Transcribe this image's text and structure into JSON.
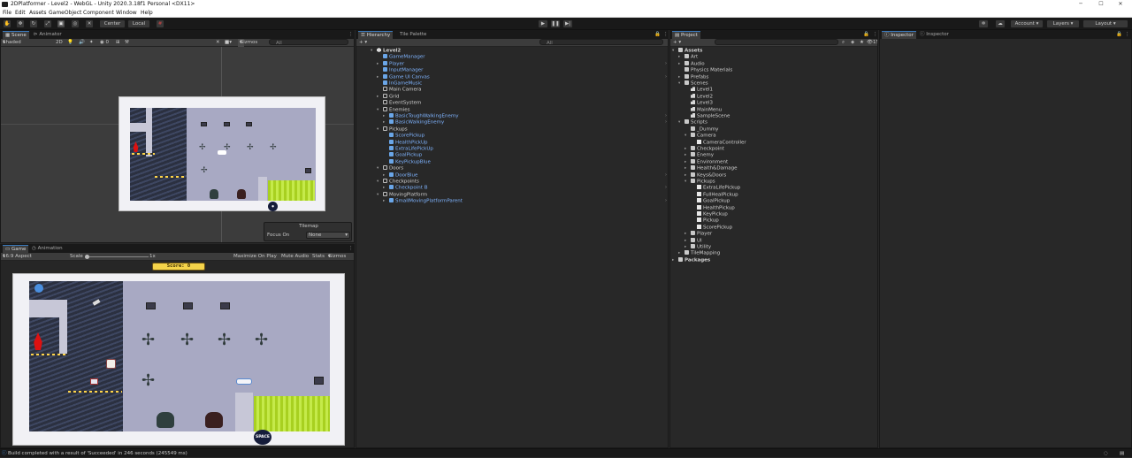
{
  "window": {
    "title": "2DPlatformer - Level2 - WebGL - Unity 2020.3.18f1 Personal <DX11>"
  },
  "menu": [
    "File",
    "Edit",
    "Assets",
    "GameObject",
    "Component",
    "Window",
    "Help"
  ],
  "toolbar": {
    "center": "Center",
    "local": "Local",
    "account": "Account",
    "layers": "Layers",
    "layout": "Layout"
  },
  "scene": {
    "tabs": [
      "Scene",
      "Animator"
    ],
    "shading": "Shaded",
    "mode2d": "2D",
    "gizmos": "Gizmos",
    "search_placeholder": "All",
    "tilemap": {
      "title": "Tilemap",
      "focus_label": "Focus On",
      "focus_value": "None"
    }
  },
  "game": {
    "tabs": [
      "Game",
      "Animation"
    ],
    "aspect": "16:9 Aspect",
    "scale_label": "Scale",
    "scale_value": "1x",
    "maximize": "Maximize On Play",
    "mute": "Mute Audio",
    "stats": "Stats",
    "gizmos": "Gizmos",
    "score": "Score: 0",
    "start_badge": "SPACE"
  },
  "hierarchy": {
    "tabs": [
      "Hierarchy",
      "Tile Palette"
    ],
    "search_placeholder": "All",
    "items": [
      {
        "label": "Level2",
        "depth": 0,
        "icon": "unity",
        "prefab": false,
        "arrow": "▾",
        "bold": true
      },
      {
        "label": "GameManager",
        "depth": 1,
        "icon": "cube",
        "prefab": true,
        "arrow": ""
      },
      {
        "label": "Player",
        "depth": 1,
        "icon": "cube",
        "prefab": true,
        "arrow": "▸"
      },
      {
        "label": "InputManager",
        "depth": 1,
        "icon": "cube",
        "prefab": true,
        "arrow": ""
      },
      {
        "label": "Game UI Canvas",
        "depth": 1,
        "icon": "cube",
        "prefab": true,
        "arrow": "▸"
      },
      {
        "label": "InGameMusic",
        "depth": 1,
        "icon": "cube",
        "prefab": true,
        "arrow": ""
      },
      {
        "label": "Main Camera",
        "depth": 1,
        "icon": "go",
        "prefab": false,
        "arrow": ""
      },
      {
        "label": "Grid",
        "depth": 1,
        "icon": "go",
        "prefab": false,
        "arrow": "▸"
      },
      {
        "label": "EventSystem",
        "depth": 1,
        "icon": "go",
        "prefab": false,
        "arrow": ""
      },
      {
        "label": "Enemies",
        "depth": 1,
        "icon": "go",
        "prefab": false,
        "arrow": "▾"
      },
      {
        "label": "BasicToughWalkingEnemy",
        "depth": 2,
        "icon": "cube",
        "prefab": true,
        "arrow": "▸"
      },
      {
        "label": "BasicWalkingEnemy",
        "depth": 2,
        "icon": "cube",
        "prefab": true,
        "arrow": "▸"
      },
      {
        "label": "Pickups",
        "depth": 1,
        "icon": "go",
        "prefab": false,
        "arrow": "▾"
      },
      {
        "label": "ScorePickup",
        "depth": 2,
        "icon": "cube",
        "prefab": true,
        "arrow": ""
      },
      {
        "label": "HealthPickUp",
        "depth": 2,
        "icon": "cube",
        "prefab": true,
        "arrow": ""
      },
      {
        "label": "ExtraLifePickUp",
        "depth": 2,
        "icon": "cube",
        "prefab": true,
        "arrow": ""
      },
      {
        "label": "GoalPickup",
        "depth": 2,
        "icon": "cube",
        "prefab": true,
        "arrow": ""
      },
      {
        "label": "KeyPickupBlue",
        "depth": 2,
        "icon": "cube",
        "prefab": true,
        "arrow": ""
      },
      {
        "label": "Doors",
        "depth": 1,
        "icon": "go",
        "prefab": false,
        "arrow": "▾"
      },
      {
        "label": "DoorBlue",
        "depth": 2,
        "icon": "cube",
        "prefab": true,
        "arrow": "▸"
      },
      {
        "label": "Checkpoints",
        "depth": 1,
        "icon": "go",
        "prefab": false,
        "arrow": "▾"
      },
      {
        "label": "Checkpoint B",
        "depth": 2,
        "icon": "cube",
        "prefab": true,
        "arrow": "▸"
      },
      {
        "label": "MovingPlatform",
        "depth": 1,
        "icon": "go",
        "prefab": false,
        "arrow": "▾"
      },
      {
        "label": "SmallMovingPlatformParent",
        "depth": 2,
        "icon": "cube",
        "prefab": true,
        "arrow": "▸"
      }
    ]
  },
  "project": {
    "tabs": [
      "Project"
    ],
    "hidden_count": "15",
    "items": [
      {
        "label": "Assets",
        "depth": 0,
        "icon": "fold",
        "arrow": "▾",
        "bold": true
      },
      {
        "label": "Art",
        "depth": 1,
        "icon": "fold",
        "arrow": "▸"
      },
      {
        "label": "Audio",
        "depth": 1,
        "icon": "fold",
        "arrow": "▸"
      },
      {
        "label": "Physics Materials",
        "depth": 1,
        "icon": "fold",
        "arrow": ""
      },
      {
        "label": "Prefabs",
        "depth": 1,
        "icon": "fold",
        "arrow": "▸"
      },
      {
        "label": "Scenes",
        "depth": 1,
        "icon": "fold",
        "arrow": "▾"
      },
      {
        "label": "Level1",
        "depth": 2,
        "icon": "scn",
        "arrow": ""
      },
      {
        "label": "Level2",
        "depth": 2,
        "icon": "scn",
        "arrow": ""
      },
      {
        "label": "Level3",
        "depth": 2,
        "icon": "scn",
        "arrow": ""
      },
      {
        "label": "MainMenu",
        "depth": 2,
        "icon": "scn",
        "arrow": ""
      },
      {
        "label": "SampleScene",
        "depth": 2,
        "icon": "scn",
        "arrow": ""
      },
      {
        "label": "Scripts",
        "depth": 1,
        "icon": "fold",
        "arrow": "▾"
      },
      {
        "label": "_Dummy",
        "depth": 2,
        "icon": "fold",
        "arrow": ""
      },
      {
        "label": "Camera",
        "depth": 2,
        "icon": "fold",
        "arrow": "▾"
      },
      {
        "label": "CameraController",
        "depth": 3,
        "icon": "cs",
        "arrow": ""
      },
      {
        "label": "Checkpoint",
        "depth": 2,
        "icon": "fold",
        "arrow": "▸"
      },
      {
        "label": "Enemy",
        "depth": 2,
        "icon": "fold",
        "arrow": "▸"
      },
      {
        "label": "Environment",
        "depth": 2,
        "icon": "fold",
        "arrow": "▸"
      },
      {
        "label": "Health&Damage",
        "depth": 2,
        "icon": "fold",
        "arrow": "▸"
      },
      {
        "label": "Keys&Doors",
        "depth": 2,
        "icon": "fold",
        "arrow": "▸"
      },
      {
        "label": "Pickups",
        "depth": 2,
        "icon": "fold",
        "arrow": "▾"
      },
      {
        "label": "ExtraLifePickup",
        "depth": 3,
        "icon": "cs",
        "arrow": ""
      },
      {
        "label": "FullHealPickup",
        "depth": 3,
        "icon": "cs",
        "arrow": ""
      },
      {
        "label": "GoalPickup",
        "depth": 3,
        "icon": "cs",
        "arrow": ""
      },
      {
        "label": "HealthPickup",
        "depth": 3,
        "icon": "cs",
        "arrow": ""
      },
      {
        "label": "KeyPickup",
        "depth": 3,
        "icon": "cs",
        "arrow": ""
      },
      {
        "label": "Pickup",
        "depth": 3,
        "icon": "cs",
        "arrow": ""
      },
      {
        "label": "ScorePickup",
        "depth": 3,
        "icon": "cs",
        "arrow": ""
      },
      {
        "label": "Player",
        "depth": 2,
        "icon": "fold",
        "arrow": "▸"
      },
      {
        "label": "UI",
        "depth": 2,
        "icon": "fold",
        "arrow": "▸"
      },
      {
        "label": "Utility",
        "depth": 2,
        "icon": "fold",
        "arrow": "▸"
      },
      {
        "label": "TileMapping",
        "depth": 1,
        "icon": "fold",
        "arrow": "▸"
      },
      {
        "label": "Packages",
        "depth": 0,
        "icon": "fold",
        "arrow": "▸",
        "bold": true
      }
    ]
  },
  "inspector": {
    "tabs": [
      "Inspector",
      "Inspector"
    ]
  },
  "status": {
    "text": "Build completed with a result of 'Succeeded' in 246 seconds (245549 ms)"
  },
  "colors": {
    "accent": "#3a79bb",
    "prefab": "#7fb4ff",
    "panel_bg": "#282828",
    "toolbar_bg": "#191919"
  }
}
